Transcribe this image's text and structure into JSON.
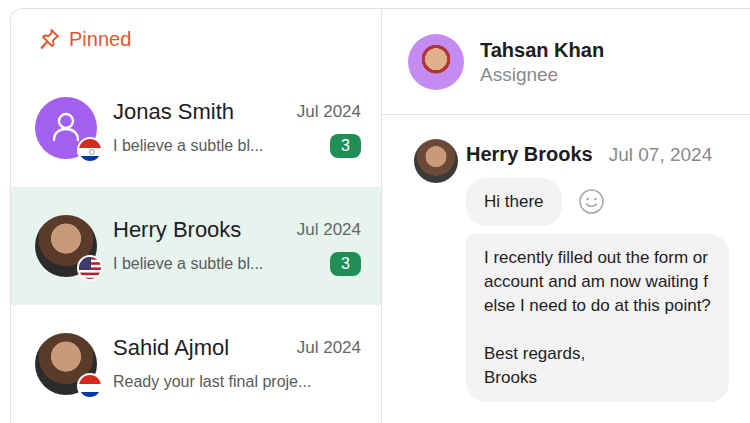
{
  "sidebar": {
    "header": "Pinned",
    "items": [
      {
        "name": "Jonas Smith",
        "date": "Jul 2024",
        "preview": "I believe a subtle bl...",
        "badge": "3",
        "selected": false,
        "kind": "icon"
      },
      {
        "name": "Herry Brooks",
        "date": "Jul 2024",
        "preview": "I believe a subtle bl...",
        "badge": "3",
        "selected": true,
        "kind": "photo"
      },
      {
        "name": "Sahid Ajmol",
        "date": "Jul 2024",
        "preview": "Ready your last final proje...",
        "selected": false,
        "kind": "photo"
      }
    ]
  },
  "conversation": {
    "assignee": {
      "name": "Tahsan Khan",
      "role": "Assignee"
    },
    "messages": [
      {
        "author": "Herry Brooks",
        "date": "Jul 07, 2024",
        "bubbles": [
          {
            "lines": [
              "Hi there"
            ]
          },
          {
            "lines": [
              "I recently filled out the form or",
              "account and am now waiting f",
              "else I need to do at this point?",
              "",
              "Best regards,",
              "Brooks"
            ]
          }
        ]
      }
    ]
  }
}
